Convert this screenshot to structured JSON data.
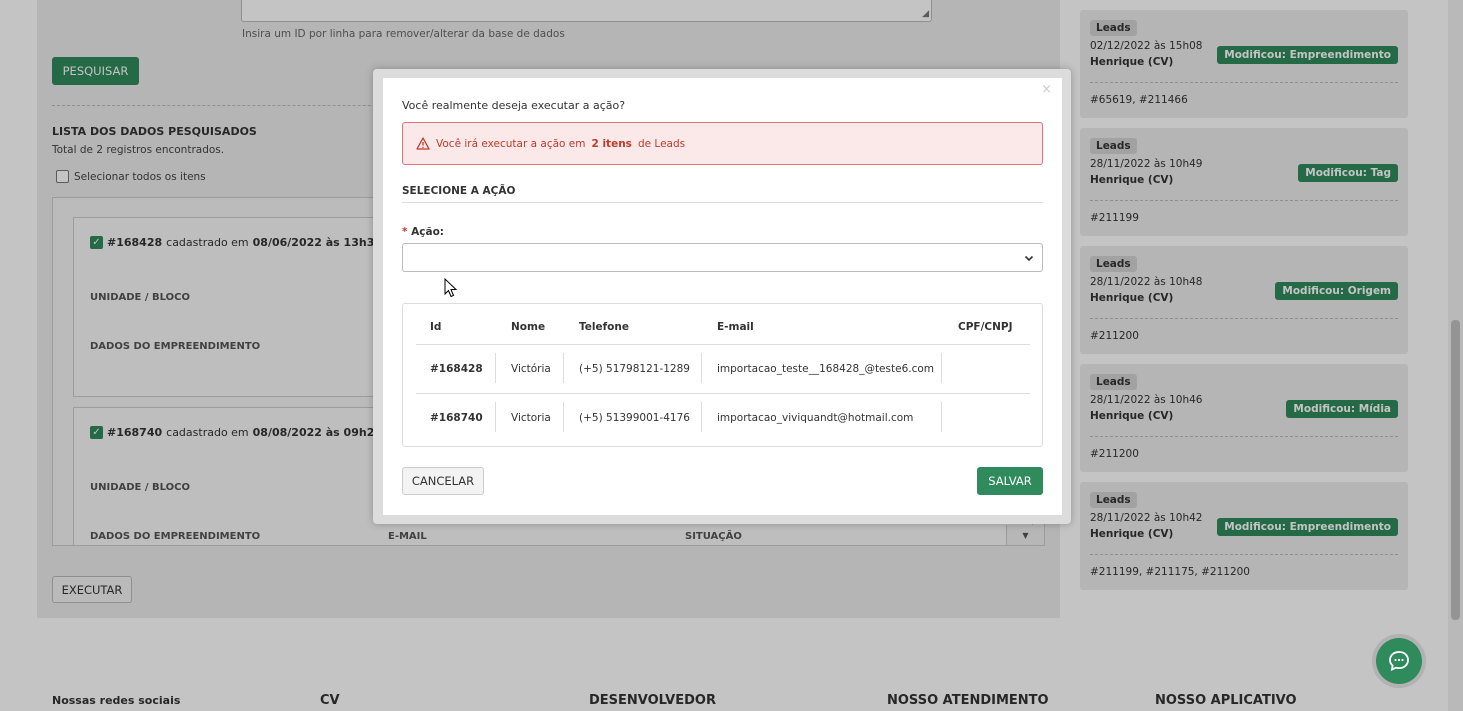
{
  "background": {
    "hint": "Insira um ID por linha para remover/alterar da base de dados",
    "search_button": "PESQUISAR",
    "list_title": "LISTA DOS DADOS PESQUISADOS",
    "list_subtitle": "Total de 2 registros encontrados.",
    "select_all_label": "Selecionar todos os itens",
    "records": [
      {
        "id": "#168428",
        "registered_text": "cadastrado em",
        "date": "08/06/2022 às 13h32",
        "label_unit": "UNIDADE / BLOCO",
        "label_dev": "DADOS DO EMPREENDIMENTO"
      },
      {
        "id": "#168740",
        "registered_text": "cadastrado em",
        "date": "08/08/2022 às 09h28",
        "label_unit": "UNIDADE / BLOCO",
        "label_dev": "DADOS DO EMPREENDIMENTO",
        "label_email": "E-MAIL",
        "label_status": "SITUAÇÃO"
      }
    ],
    "execute_button": "EXECUTAR"
  },
  "history": [
    {
      "badge": "Leads",
      "date": "02/12/2022 às 15h08",
      "user": "Henrique (CV)",
      "tag": "Modificou: Empreendimento",
      "ids": "#65619, #211466"
    },
    {
      "badge": "Leads",
      "date": "28/11/2022 às 10h49",
      "user": "Henrique (CV)",
      "tag": "Modificou: Tag",
      "ids": "#211199"
    },
    {
      "badge": "Leads",
      "date": "28/11/2022 às 10h48",
      "user": "Henrique (CV)",
      "tag": "Modificou: Origem",
      "ids": "#211200"
    },
    {
      "badge": "Leads",
      "date": "28/11/2022 às 10h46",
      "user": "Henrique (CV)",
      "tag": "Modificou: Mídia",
      "ids": "#211200"
    },
    {
      "badge": "Leads",
      "date": "28/11/2022 às 10h42",
      "user": "Henrique (CV)",
      "tag": "Modificou: Empreendimento",
      "ids": "#211199, #211175, #211200"
    }
  ],
  "footer": {
    "social": "Nossas redes sociais",
    "cv": "CV",
    "developer": "DESENVOLVEDOR",
    "support": "NOSSO ATENDIMENTO",
    "app": "NOSSO APLICATIVO"
  },
  "modal": {
    "close": "×",
    "question": "Você realmente deseja executar a ação?",
    "alert_prefix": "Você irá executar a ação em",
    "alert_count": "2 itens",
    "alert_suffix": "de Leads",
    "section_title": "SELECIONE A AÇÃO",
    "action_required": "*",
    "action_label": "Ação:",
    "action_value": "",
    "table": {
      "headers": [
        "Id",
        "Nome",
        "Telefone",
        "E-mail",
        "CPF/CNPJ"
      ],
      "rows": [
        {
          "id": "#168428",
          "name": "Victória",
          "phone": "(+5) 51798121-1289",
          "email": "importacao_teste__168428_@teste6.com",
          "cpf": ""
        },
        {
          "id": "#168740",
          "name": "Victoria",
          "phone": "(+5) 51399001-4176",
          "email": "importacao_viviquandt@hotmail.com",
          "cpf": ""
        }
      ]
    },
    "cancel_button": "CANCELAR",
    "save_button": "SALVAR"
  },
  "colors": {
    "primary_green": "#2f8a5c",
    "alert_red": "#c0392b",
    "alert_bg": "#fbe9ea"
  }
}
